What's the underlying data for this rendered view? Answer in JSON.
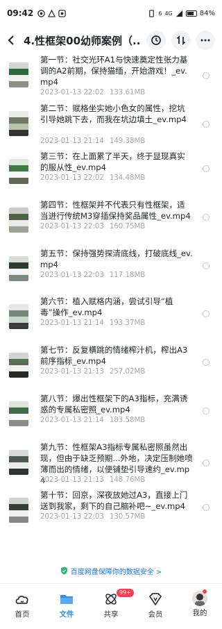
{
  "status_bar": {
    "time": "09:42",
    "signal_labels": [
      "6",
      "4G"
    ],
    "battery": "84%",
    "battery_level": 0.84
  },
  "header": {
    "back_icon": "chevron-left-icon",
    "title": "4.性框架00幼师案例（...",
    "history_icon": "history-icon",
    "sort_icon": "sort-icon",
    "more_icon": "more-icon"
  },
  "files": [
    {
      "name": "第一节：社交光环A1与快速奠定性张力基调的A2前期，保持猫缅，开始游戏！_ev.mp4",
      "date": "2023-01-13  22:02",
      "size": "133.61MB"
    },
    {
      "name": "第二节：赋格坐实她小色女的属性，挖坑引导她跳下去，而我在坑边填土_ev.mp4",
      "date": "2023-01-13  21:14",
      "size": "149.38MB"
    },
    {
      "name": "第三节：在上面累了半天，终于显现真实的服从性_ev.mp4",
      "date": "2023-01-13  22:02",
      "size": "134.48MB"
    },
    {
      "name": "第四节：性框架并不代表只有性框架，适当进行传统M3穿插保持奖品属性_ev.mp4",
      "date": "2023-01-13  22:03",
      "size": "160.75MB"
    },
    {
      "name": "第五节：保持强势探清底线，打破底线_ev.mp4",
      "date": "2023-01-13  22:03",
      "size": "117.18MB"
    },
    {
      "name": "第六节：植入赋格内涵，尝试引导“植毒”操作_ev.mp4",
      "date": "2023-01-13  21:14",
      "size": "193.37MB"
    },
    {
      "name": "第七节：反复横跳的情绪榨汁机，榨出A3前序指标_ev.mp4",
      "date": "2023-01-13  21:13",
      "size": "257.02MB"
    },
    {
      "name": "第八节：爆出性框架下的A3指标，充满诱惑的专属私密照_ev.mp4",
      "date": "2023-01-13  21:14",
      "size": "183.58MB"
    },
    {
      "name": "第九节：性框架A3指标专属私密照虽然出现，但由于缺乏预期...外地，决定压制她喷薄而出的情绪，以便铺垫引导速约_ev.mp4",
      "date": "2023-01-13  21:13",
      "size": "148.76MB"
    },
    {
      "name": "第十节：回京，深夜放她过A3，直接上门送到我家，剩下的自己脑补吧~_ev.mp4",
      "date": "2023-01-13  22:03",
      "size": "130.57MB"
    }
  ],
  "security_notice": "百度网盘保障你的数据安全 >",
  "tabbar": {
    "items": [
      {
        "label": "首页",
        "icon": "home-cloud-icon"
      },
      {
        "label": "文件",
        "icon": "folder-icon"
      },
      {
        "label": "共享",
        "icon": "share-icon",
        "badge": "99+"
      },
      {
        "label": "会员",
        "icon": "vip-icon"
      },
      {
        "label": "我的",
        "icon": "avatar"
      }
    ],
    "active_index": 1
  },
  "colors": {
    "accent": "#2f8ff2",
    "meta_text": "#a3a6ad",
    "badge": "#ff3b4f"
  }
}
